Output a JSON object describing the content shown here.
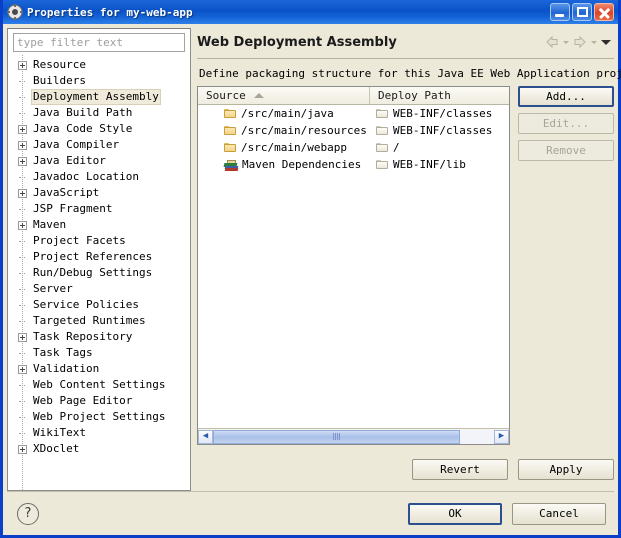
{
  "window": {
    "title": "Properties for my-web-app",
    "icon": "gear-icon",
    "minimize_label": "Minimize",
    "maximize_label": "Maximize",
    "close_label": "Close"
  },
  "sidebar": {
    "filter_placeholder": "type filter text",
    "filter_value": "",
    "items": [
      {
        "label": "Resource",
        "expandable": true,
        "selected": false
      },
      {
        "label": "Builders",
        "expandable": false,
        "selected": false
      },
      {
        "label": "Deployment Assembly",
        "expandable": false,
        "selected": true
      },
      {
        "label": "Java Build Path",
        "expandable": false,
        "selected": false
      },
      {
        "label": "Java Code Style",
        "expandable": true,
        "selected": false
      },
      {
        "label": "Java Compiler",
        "expandable": true,
        "selected": false
      },
      {
        "label": "Java Editor",
        "expandable": true,
        "selected": false
      },
      {
        "label": "Javadoc Location",
        "expandable": false,
        "selected": false
      },
      {
        "label": "JavaScript",
        "expandable": true,
        "selected": false
      },
      {
        "label": "JSP Fragment",
        "expandable": false,
        "selected": false
      },
      {
        "label": "Maven",
        "expandable": true,
        "selected": false
      },
      {
        "label": "Project Facets",
        "expandable": false,
        "selected": false
      },
      {
        "label": "Project References",
        "expandable": false,
        "selected": false
      },
      {
        "label": "Run/Debug Settings",
        "expandable": false,
        "selected": false
      },
      {
        "label": "Server",
        "expandable": false,
        "selected": false
      },
      {
        "label": "Service Policies",
        "expandable": false,
        "selected": false
      },
      {
        "label": "Targeted Runtimes",
        "expandable": false,
        "selected": false
      },
      {
        "label": "Task Repository",
        "expandable": true,
        "selected": false
      },
      {
        "label": "Task Tags",
        "expandable": false,
        "selected": false
      },
      {
        "label": "Validation",
        "expandable": true,
        "selected": false
      },
      {
        "label": "Web Content Settings",
        "expandable": false,
        "selected": false
      },
      {
        "label": "Web Page Editor",
        "expandable": false,
        "selected": false
      },
      {
        "label": "Web Project Settings",
        "expandable": false,
        "selected": false
      },
      {
        "label": "WikiText",
        "expandable": false,
        "selected": false
      },
      {
        "label": "XDoclet",
        "expandable": true,
        "selected": false
      }
    ]
  },
  "page": {
    "title": "Web Deployment Assembly",
    "back_label": "Back",
    "forward_label": "Forward",
    "menu_label": "View Menu",
    "description": "Define packaging structure for this Java EE Web Application project."
  },
  "table": {
    "columns": [
      {
        "label": "Source",
        "sorted": "ascending"
      },
      {
        "label": "Deploy Path",
        "sorted": "none"
      }
    ],
    "rows": [
      {
        "source": "/src/main/java",
        "source_icon": "folder-icon",
        "deploy": "WEB-INF/classes",
        "deploy_icon": "folder-icon"
      },
      {
        "source": "/src/main/resources",
        "source_icon": "folder-icon",
        "deploy": "WEB-INF/classes",
        "deploy_icon": "folder-icon"
      },
      {
        "source": "/src/main/webapp",
        "source_icon": "folder-icon",
        "deploy": "/",
        "deploy_icon": "folder-icon"
      },
      {
        "source": "Maven Dependencies",
        "source_icon": "library-icon",
        "deploy": "WEB-INF/lib",
        "deploy_icon": "folder-icon"
      }
    ],
    "scroll_left_label": "Scroll left",
    "scroll_right_label": "Scroll right"
  },
  "side_buttons": {
    "add": {
      "label": "Add...",
      "enabled": true,
      "focused": true
    },
    "edit": {
      "label": "Edit...",
      "enabled": false,
      "focused": false
    },
    "remove": {
      "label": "Remove",
      "enabled": false,
      "focused": false
    }
  },
  "apply_bar": {
    "revert": "Revert",
    "apply": "Apply"
  },
  "footer": {
    "help_label": "?",
    "ok": "OK",
    "cancel": "Cancel"
  },
  "colors": {
    "titlebar_blue": "#0a52c8",
    "dialog_bg": "#ece9d8",
    "selection_bg": "#f0eada",
    "close_red": "#d8442a"
  }
}
